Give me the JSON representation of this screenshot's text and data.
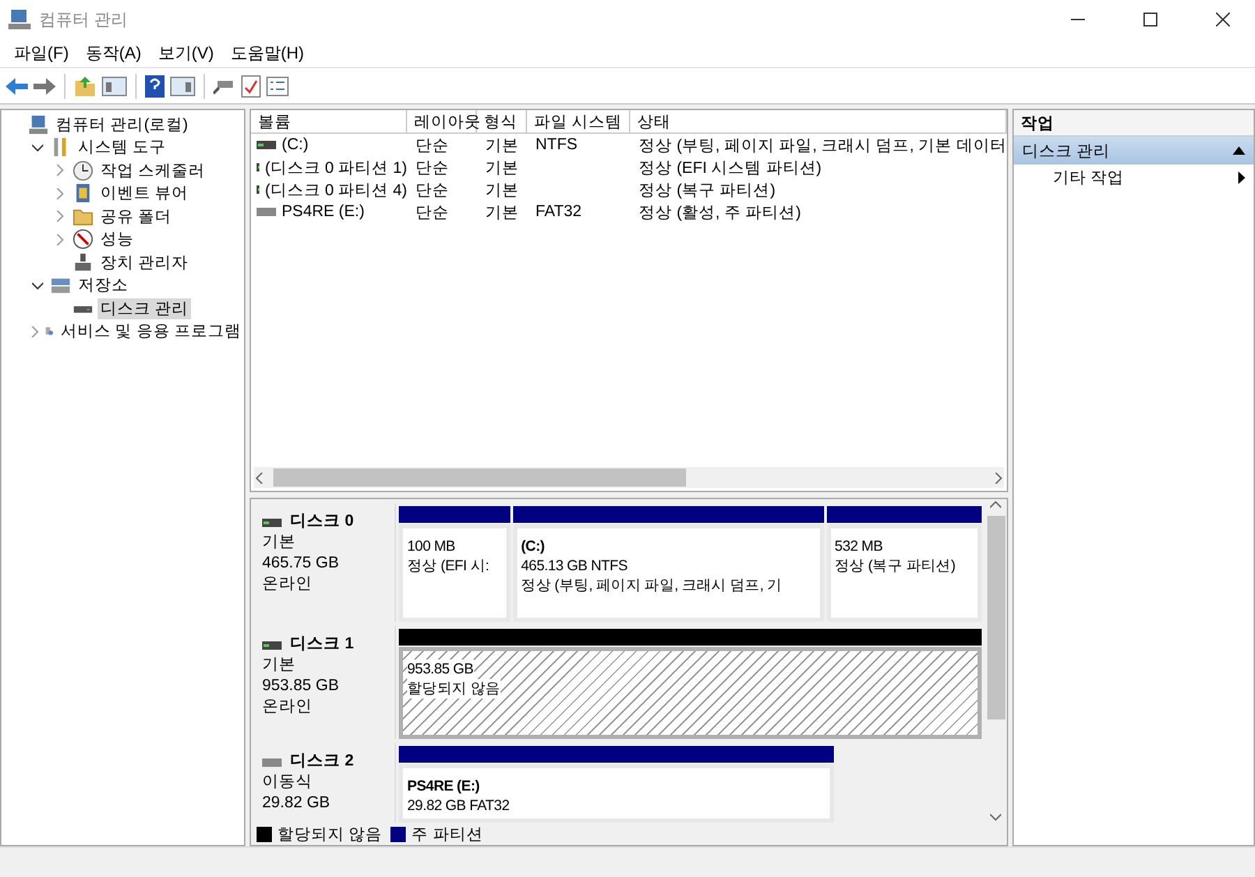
{
  "window": {
    "title": "컴퓨터 관리"
  },
  "menu": [
    "파일(F)",
    "동작(A)",
    "보기(V)",
    "도움말(H)"
  ],
  "tree": [
    {
      "label": "컴퓨터 관리(로컬)",
      "kind": "computer",
      "selected": false,
      "children": [
        {
          "label": "시스템 도구",
          "kind": "tools",
          "expanded": true,
          "selected": false,
          "children": [
            {
              "label": "작업 스케줄러",
              "kind": "clock",
              "expanded": false,
              "selected": false
            },
            {
              "label": "이벤트 뷰어",
              "kind": "event",
              "expanded": false,
              "selected": false
            },
            {
              "label": "공유 폴더",
              "kind": "folder",
              "expanded": false,
              "selected": false
            },
            {
              "label": "성능",
              "kind": "perf",
              "expanded": false,
              "selected": false
            },
            {
              "label": "장치 관리자",
              "kind": "device",
              "selected": false
            }
          ]
        },
        {
          "label": "저장소",
          "kind": "storage",
          "expanded": true,
          "selected": false,
          "children": [
            {
              "label": "디스크 관리",
              "kind": "disk",
              "selected": true
            }
          ]
        },
        {
          "label": "서비스 및 응용 프로그램",
          "kind": "services",
          "expanded": false,
          "selected": false
        }
      ]
    }
  ],
  "table": {
    "columns": [
      "볼륨",
      "레이아웃",
      "형식",
      "파일 시스템",
      "상태"
    ],
    "rows": [
      {
        "kind": "fixed",
        "cells": [
          "(C:)",
          "단순",
          "기본",
          "NTFS",
          "정상 (부팅, 페이지 파일, 크래시 덤프, 기본 데이터"
        ]
      },
      {
        "kind": "fixed",
        "cells": [
          "(디스크 0 파티션 1)",
          "단순",
          "기본",
          "",
          "정상 (EFI 시스템 파티션)"
        ]
      },
      {
        "kind": "fixed",
        "cells": [
          "(디스크 0 파티션 4)",
          "단순",
          "기본",
          "",
          "정상 (복구 파티션)"
        ]
      },
      {
        "kind": "removable",
        "cells": [
          "PS4RE (E:)",
          "단순",
          "기본",
          "FAT32",
          "정상 (활성, 주 파티션)"
        ]
      }
    ]
  },
  "disks": [
    {
      "name": "디스크 0",
      "kind": "fixed",
      "type": "기본",
      "size": "465.75 GB",
      "status": "온라인",
      "partitions": [
        {
          "kind": "primary",
          "lines": [
            "100 MB",
            "정상 (EFI 시:"
          ]
        },
        {
          "kind": "primary",
          "label": "(C:)",
          "lines": [
            "465.13 GB NTFS",
            "정상 (부팅, 페이지 파일, 크래시 덤프, 기"
          ]
        },
        {
          "kind": "primary",
          "lines": [
            "532 MB",
            "정상 (복구 파티션)"
          ]
        }
      ]
    },
    {
      "name": "디스크 1",
      "kind": "fixed",
      "type": "기본",
      "size": "953.85 GB",
      "status": "온라인",
      "partitions": [
        {
          "kind": "unallocated",
          "lines": [
            "953.85 GB",
            "할당되지 않음"
          ]
        }
      ]
    },
    {
      "name": "디스크 2",
      "kind": "removable",
      "type": "이동식",
      "size": "29.82 GB",
      "partitions": [
        {
          "kind": "primary",
          "label": "PS4RE  (E:)",
          "lines": [
            "29.82 GB FAT32"
          ]
        }
      ]
    }
  ],
  "legend": [
    {
      "label": "할당되지 않음",
      "color": "#000000"
    },
    {
      "label": "주 파티션",
      "color": "#000080"
    }
  ],
  "actions": {
    "header": "작업",
    "section": {
      "label": "디스크 관리",
      "expanded": true
    },
    "items": [
      "기타 작업"
    ]
  }
}
